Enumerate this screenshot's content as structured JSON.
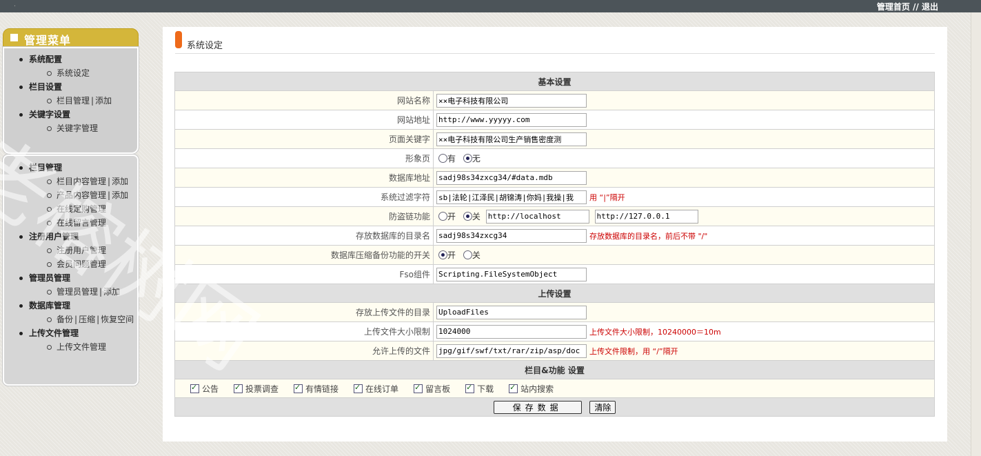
{
  "top": {
    "links": [
      "管理首页",
      "退出"
    ],
    "separator": "//"
  },
  "menu": {
    "title": "管理菜单",
    "box1": [
      {
        "label": "系统配置",
        "subs": [
          [
            "系统设定"
          ]
        ]
      },
      {
        "label": "栏目设置",
        "subs": [
          [
            "栏目管理",
            "添加"
          ]
        ]
      },
      {
        "label": "关键字设置",
        "subs": [
          [
            "关键字管理"
          ]
        ]
      }
    ],
    "box2": [
      {
        "label": "栏目管理",
        "subs": [
          [
            "栏目内容管理",
            "添加"
          ],
          [
            "产品内容管理",
            "添加"
          ],
          [
            "在线定购管理"
          ],
          [
            "在线留言管理"
          ]
        ]
      },
      {
        "label": "注册用户管理",
        "subs": [
          [
            "注册用户管理"
          ],
          [
            "会员问题管理"
          ]
        ]
      },
      {
        "label": "管理员管理",
        "subs": [
          [
            "管理员管理",
            "添加"
          ]
        ]
      },
      {
        "label": "数据库管理",
        "subs": [
          [
            "备份",
            "压缩",
            "恢复空间"
          ]
        ]
      },
      {
        "label": "上传文件管理",
        "subs": [
          [
            "上传文件管理"
          ]
        ]
      }
    ]
  },
  "page": {
    "title": "系统设定"
  },
  "basic": {
    "header": "基本设置",
    "site_name_label": "网站名称",
    "site_name": "××电子科技有限公司",
    "site_url_label": "网站地址",
    "site_url": "http://www.yyyyy.com",
    "keywords_label": "页面关键字",
    "keywords": "××电子科技有限公司生产销售密度测",
    "splash_label": "形象页",
    "splash_yes": "有",
    "splash_no": "无",
    "db_path_label": "数据库地址",
    "db_path": "sadj98s34zxcg34/#data.mdb",
    "filter_label": "系统过滤字符",
    "filter": "sb|法轮|江泽民|胡锦涛|你妈|我操|我",
    "filter_note": "用 “|”隔开",
    "hotlink_label": "防盗链功能",
    "hotlink_on": "开",
    "hotlink_off": "关",
    "hotlink_url1": "http://localhost",
    "hotlink_url2": "http://127.0.0.1",
    "db_dir_label": "存放数据库的目录名",
    "db_dir": "sadj98s34zxcg34",
    "db_dir_note": "存放数据库的目录名，前后不带 \"/\"",
    "db_compress_label": "数据库压缩备份功能的开关",
    "db_compress_on": "开",
    "db_compress_off": "关",
    "fso_label": "Fso组件",
    "fso": "Scripting.FileSystemObject"
  },
  "upload": {
    "header": "上传设置",
    "dir_label": "存放上传文件的目录",
    "dir": "UploadFiles",
    "size_label": "上传文件大小限制",
    "size": "1024000",
    "size_note": "上传文件大小限制，10240000＝10m",
    "types_label": "允许上传的文件",
    "types": "jpg/gif/swf/txt/rar/zip/asp/doc",
    "types_note": "上传文件限制，用 “/”隔开"
  },
  "features": {
    "header": "栏目&功能 设置",
    "items": [
      "公告",
      "投票调查",
      "有情链接",
      "在线订单",
      "留言板",
      "下载",
      "站内搜索"
    ]
  },
  "buttons": {
    "save": "保存数据",
    "clear": "清除"
  },
  "watermark": "老榕树网"
}
